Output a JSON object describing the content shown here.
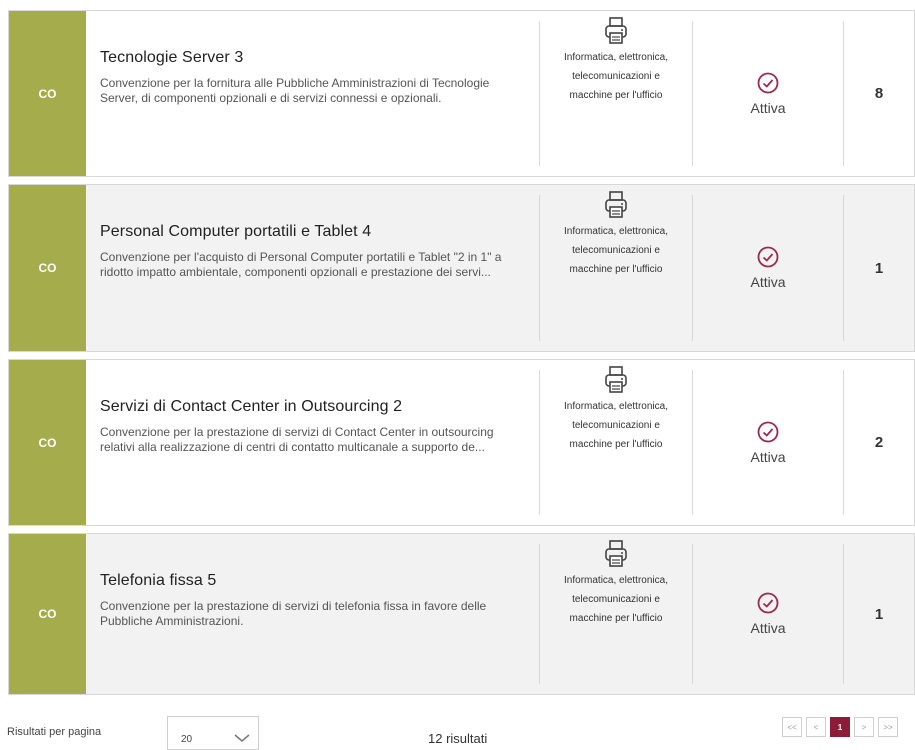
{
  "colors": {
    "badge": "#a4ac4c",
    "status_icon": "#9b2a4e",
    "pager_active": "#8b1d3a"
  },
  "cards": [
    {
      "badge": "CO",
      "title": "Tecnologie Server 3",
      "description": "Convenzione per la fornitura alle Pubbliche Amministrazioni di Tecnologie Server, di componenti opzionali e di servizi connessi e opzionali.",
      "category_icon": "printer-icon",
      "category": "Informatica, elettronica, telecomunicazioni e macchine per l'ufficio",
      "status_icon": "check-circle-icon",
      "status": "Attiva",
      "count": "8"
    },
    {
      "badge": "CO",
      "title": "Personal Computer portatili e Tablet 4",
      "description": "Convenzione per l'acquisto di Personal Computer portatili e Tablet \"2 in 1\" a ridotto impatto ambientale, componenti opzionali e prestazione dei servi...",
      "category_icon": "printer-icon",
      "category": "Informatica, elettronica, telecomunicazioni e macchine per l'ufficio",
      "status_icon": "check-circle-icon",
      "status": "Attiva",
      "count": "1"
    },
    {
      "badge": "CO",
      "title": "Servizi di Contact Center in Outsourcing 2",
      "description": "Convenzione per la prestazione di servizi di Contact Center in outsourcing relativi alla realizzazione di centri di contatto multicanale a supporto de...",
      "category_icon": "printer-icon",
      "category": "Informatica, elettronica, telecomunicazioni e macchine per l'ufficio",
      "status_icon": "check-circle-icon",
      "status": "Attiva",
      "count": "2"
    },
    {
      "badge": "CO",
      "title": "Telefonia fissa 5",
      "description": "Convenzione per la prestazione di servizi di telefonia fissa in favore delle Pubbliche Amministrazioni.",
      "category_icon": "printer-icon",
      "category": "Informatica, elettronica, telecomunicazioni e macchine per l'ufficio",
      "status_icon": "check-circle-icon",
      "status": "Attiva",
      "count": "1"
    }
  ],
  "footer": {
    "per_page_label": "Risultati per pagina",
    "per_page_value": "20",
    "results_text": "12 risultati",
    "pager": {
      "first": "<<",
      "prev": "<",
      "current": "1",
      "next": ">",
      "last": ">>"
    }
  }
}
